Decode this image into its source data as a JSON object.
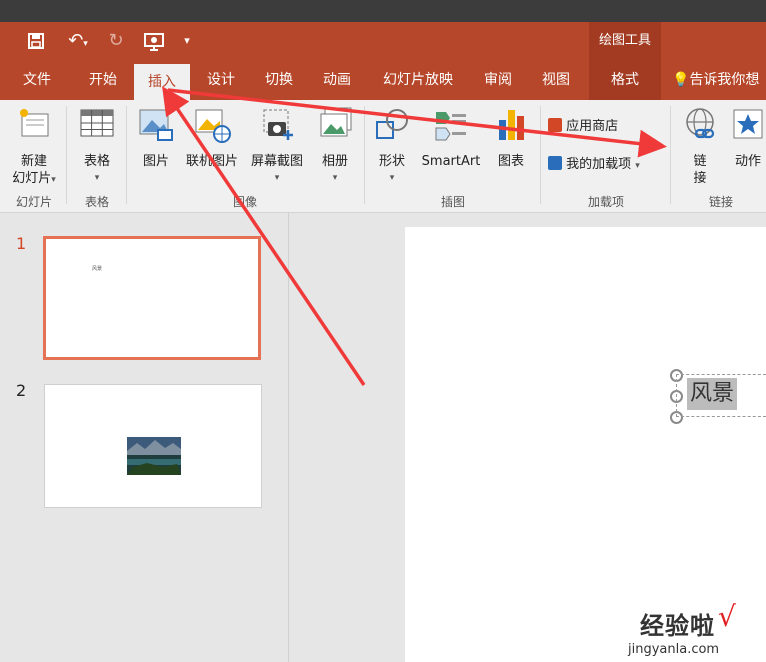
{
  "window": {
    "title": ""
  },
  "context_tab_group": "绘图工具",
  "tabs": [
    "文件",
    "开始",
    "插入",
    "设计",
    "切换",
    "动画",
    "幻灯片放映",
    "审阅",
    "视图",
    "格式"
  ],
  "tell_me": "告诉我你想",
  "ribbon": {
    "new_slide": {
      "line1": "新建",
      "line2": "幻灯片"
    },
    "table": "表格",
    "picture": "图片",
    "online_picture": "联机图片",
    "screenshot": "屏幕截图",
    "album": "相册",
    "shapes": "形状",
    "smartart": "SmartArt",
    "chart": "图表",
    "app_store": "应用商店",
    "my_addins": "我的加载项",
    "link": {
      "line1": "链",
      "line2": "接"
    },
    "action": "动作",
    "groups": {
      "slides": "幻灯片",
      "tables": "表格",
      "images": "图像",
      "illustrations": "插图",
      "addins": "加载项",
      "links": "链接"
    }
  },
  "slides": [
    {
      "number": "1",
      "text": "风景"
    },
    {
      "number": "2"
    }
  ],
  "main_slide": {
    "text": "风景"
  },
  "watermark": {
    "text": "经验啦",
    "check": "√",
    "url": "jingyanla.com"
  },
  "colors": {
    "accent": "#b7472a",
    "arrow": "#f03a3a"
  }
}
